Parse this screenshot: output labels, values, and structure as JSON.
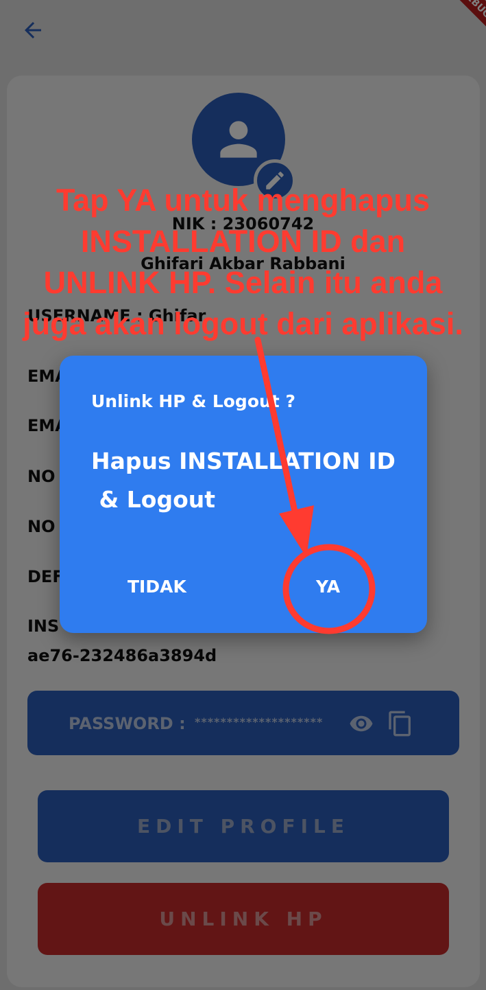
{
  "header": {
    "back_icon": "arrow-left-icon",
    "debug_badge": "DEBUG"
  },
  "profile": {
    "avatar_icon": "person-icon",
    "edit_icon": "pencil-icon",
    "nik": "NIK : 23060742",
    "name": "Ghifari Akbar Rabbani",
    "username": "USERNAME : Ghifar",
    "fields": [
      "EMA",
      "EMA",
      "NO",
      "NO",
      "DEF",
      "INS"
    ],
    "installation_id_tail": "ae76-232486a3894d"
  },
  "password": {
    "label": "PASSWORD :",
    "mask": "********************",
    "eye_icon": "eye-icon",
    "copy_icon": "copy-icon"
  },
  "buttons": {
    "edit_profile": "EDIT PROFILE",
    "unlink_hp": "UNLINK HP"
  },
  "dialog": {
    "title": "Unlink HP & Logout ?",
    "body_line1": "Hapus INSTALLATION ID",
    "body_line2": " & Logout",
    "cancel": "TIDAK",
    "confirm": "YA"
  },
  "annotation": {
    "line1": "Tap YA untuk menghapus",
    "line2": "INSTALLATION ID dan",
    "line3": "UNLINK HP. Selain itu anda",
    "line4": "juga akan logout dari aplikasi.",
    "color": "#ff3b30"
  },
  "colors": {
    "primary": "#2a5cb8",
    "dialog": "#2f7cef",
    "danger": "#c42b2b"
  }
}
